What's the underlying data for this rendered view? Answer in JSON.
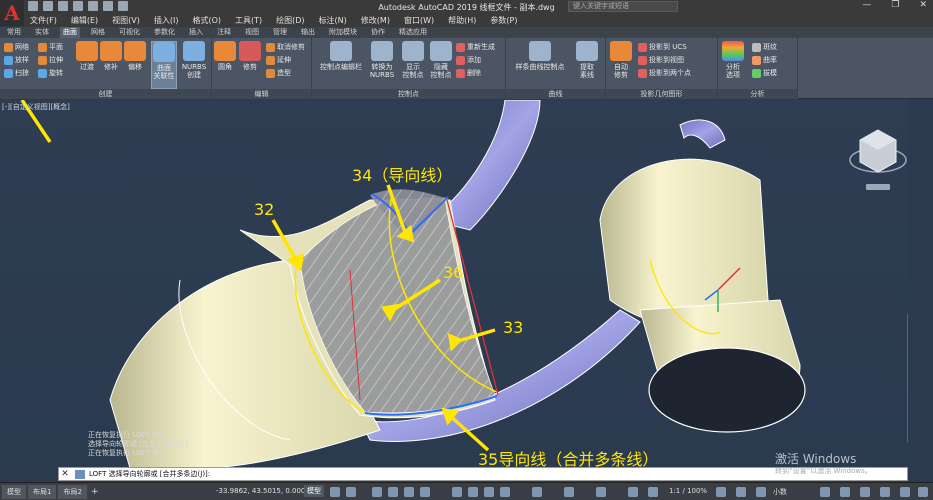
{
  "app": {
    "logo_letter": "A",
    "title": "Autodesk AutoCAD 2019    线框文件 - 副本.dwg",
    "search_placeholder": "键入关键字或短语"
  },
  "window_controls": [
    "—",
    "❐",
    "✕"
  ],
  "menu": [
    "文件(F)",
    "编辑(E)",
    "视图(V)",
    "插入(I)",
    "格式(O)",
    "工具(T)",
    "绘图(D)",
    "标注(N)",
    "修改(M)",
    "窗口(W)",
    "帮助(H)",
    "参数(P)"
  ],
  "ribbon_tabs": [
    {
      "label": "常用",
      "active": false
    },
    {
      "label": "实体",
      "active": false
    },
    {
      "label": "曲面",
      "active": true
    },
    {
      "label": "网格",
      "active": false
    },
    {
      "label": "可视化",
      "active": false
    },
    {
      "label": "参数化",
      "active": false
    },
    {
      "label": "插入",
      "active": false
    },
    {
      "label": "注释",
      "active": false
    },
    {
      "label": "视图",
      "active": false
    },
    {
      "label": "管理",
      "active": false
    },
    {
      "label": "输出",
      "active": false
    },
    {
      "label": "附加模块",
      "active": false
    },
    {
      "label": "协作",
      "active": false
    },
    {
      "label": "精选应用",
      "active": false
    }
  ],
  "ribbon": {
    "create": {
      "title": "创建",
      "small": [
        "网络",
        "放样",
        "扫掠",
        "平面",
        "拉伸",
        "旋转"
      ],
      "big": [
        "过渡",
        "修补",
        "偏移",
        "曲面\n关联性",
        "NURBS\n创建"
      ]
    },
    "edit": {
      "title": "编辑",
      "big": [
        "圆角",
        "修剪"
      ],
      "small": [
        "取消修剪",
        "延伸",
        "造型"
      ]
    },
    "cp": {
      "title": "控制点",
      "big": [
        "控制点编辑栏",
        "转换为\nNURBS",
        "显示\n控制点",
        "隐藏\n控制点"
      ],
      "small": [
        "重新生成",
        "添加",
        "删除"
      ]
    },
    "curves": {
      "title": "曲线",
      "big": [
        "样条曲线控制点",
        "提取\n素线"
      ]
    },
    "project": {
      "title": "投影几何图形",
      "big": [
        "自动\n修剪"
      ],
      "small": [
        "投影到 UCS",
        "投影到视图",
        "投影到两个点"
      ]
    },
    "analysis": {
      "title": "分析",
      "big": [
        "分析\n选项"
      ],
      "small": [
        "斑纹",
        "曲率",
        "拔模"
      ]
    }
  },
  "viewport_label": "[-][自定义视图][概念]",
  "annotations": {
    "a34": "34（导向线）",
    "a32": "32",
    "a36": "36",
    "a33": "33",
    "a35": "35导向线（合并多条线）"
  },
  "command_history": [
    "正在恢复执行 LOFT 命令。",
    "选择导向轮廓或 [合并多条边(J)]:",
    "正在恢复执行 LOFT 命令。"
  ],
  "command_prompt": "LOFT 选择导向轮廓或 [合并多条边(J)]:",
  "watermark": {
    "title": "激活 Windows",
    "sub": "转到“设置”以激活 Windows。"
  },
  "status": {
    "tabs": [
      "模型",
      "布局1",
      "布局2"
    ],
    "coords": "-33.9862, 43.5015, 0.0000",
    "model_label": "模型",
    "scale": "1:1 / 100%",
    "units": "小数"
  },
  "colors": {
    "annotation": "#ffe600",
    "surface_purple": "#8f8fd6",
    "tube": "#f4f1c8",
    "guide": "#2f6bff",
    "section": "#e0303a"
  }
}
